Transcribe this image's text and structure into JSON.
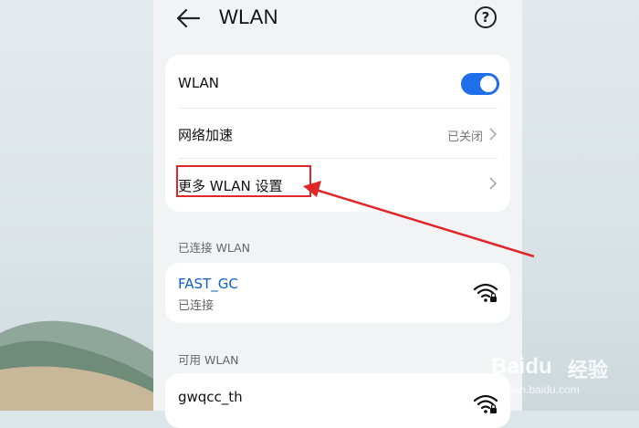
{
  "header": {
    "title": "WLAN",
    "back_icon": "arrow-left-icon",
    "help_icon": "question-circle-icon",
    "help_glyph": "?"
  },
  "settings": {
    "wlan_label": "WLAN",
    "wlan_enabled": true,
    "network_accel_label": "网络加速",
    "network_accel_value": "已关闭",
    "more_settings_label": "更多 WLAN 设置"
  },
  "connected": {
    "section_title": "已连接 WLAN",
    "network_name": "FAST_GC",
    "status": "已连接"
  },
  "available": {
    "section_title": "可用 WLAN",
    "networks": [
      {
        "name": "gwqcc_th"
      }
    ]
  },
  "annotation": {
    "highlight_color": "#e1262a"
  },
  "watermark": {
    "brand_latin": "Bai",
    "brand_paw": "du",
    "brand_cn": "经验",
    "url": "jingyan.baidu.com"
  },
  "colors": {
    "accent": "#1f6feb",
    "connected_name": "#0d5fc9"
  }
}
